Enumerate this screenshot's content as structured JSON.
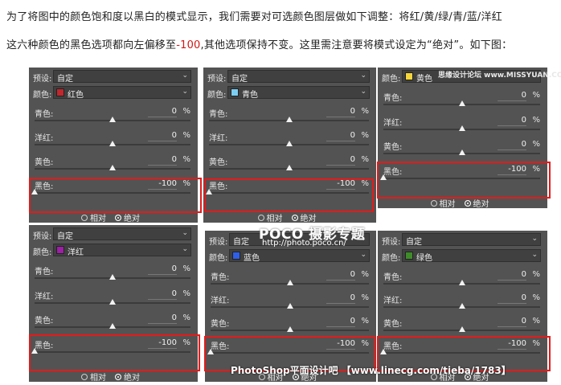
{
  "intro": {
    "line1": "为了将图中的颜色饱和度以黑白的模式显示，我们需要对可选颜色图层做如下调整：将红/黄/绿/青/蓝/洋红",
    "line2_a": "这六种颜色的黑色选项都向左偏移至",
    "line2_value": "-100",
    "line2_b": ",其他选项保持不变。这里需注意要将模式设定为“绝对”。如下图："
  },
  "labels": {
    "preset": "预设:",
    "color": "颜色:",
    "cyan": "青色:",
    "magenta": "洋红:",
    "yellow": "黄色:",
    "black": "黑色:",
    "pct": "%",
    "relative": "相对",
    "absolute": "绝对"
  },
  "panels": [
    {
      "preset": "自定",
      "color_name": "红色",
      "swatch": "#c1272d",
      "cyan": "0",
      "magenta": "0",
      "yellow": "0",
      "black": "-100"
    },
    {
      "preset": "自定",
      "color_name": "青色",
      "swatch": "#7ccdf2",
      "cyan": "0",
      "magenta": "0",
      "yellow": "0",
      "black": "-100"
    },
    {
      "preset": "",
      "color_name": "黄色",
      "swatch": "#f4d53a",
      "cyan": "0",
      "magenta": "0",
      "yellow": "0",
      "black": "-100"
    },
    {
      "preset": "自定",
      "color_name": "洋红",
      "swatch": "#9d1fa6",
      "cyan": "0",
      "magenta": "0",
      "yellow": "0",
      "black": "-100"
    },
    {
      "preset": "自定",
      "color_name": "蓝色",
      "swatch": "#2f5fe8",
      "cyan": "0",
      "magenta": "0",
      "yellow": "0",
      "black": "-100"
    },
    {
      "preset": "自定",
      "color_name": "绿色",
      "swatch": "#3f8b2a",
      "cyan": "0",
      "magenta": "0",
      "yellow": "0",
      "black": "-100"
    }
  ],
  "watermarks": {
    "top_right": "思缘设计论坛 www.MISSYUAN.COM",
    "poco_brand": "POCO 摄影专题",
    "poco_url": "http://photo.poco.cn/",
    "footer": "PhotoShop平面设计吧 【www.linecg.com/tieba/1783】"
  },
  "colors": {
    "highlight": "#e31b1b",
    "panel_bg": "#535353",
    "accent_text": "#d01818"
  }
}
